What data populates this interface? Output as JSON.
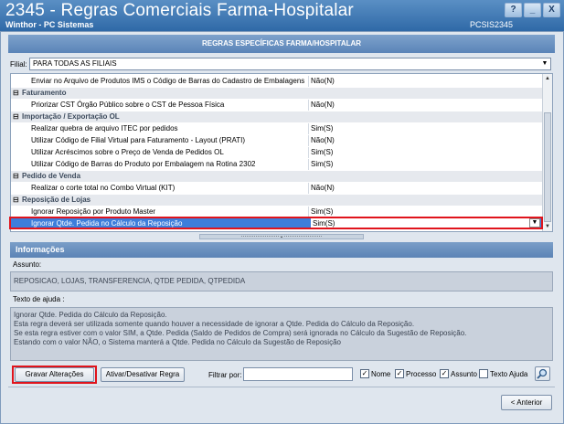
{
  "window": {
    "title": "2345 - Regras Comerciais Farma-Hospitalar",
    "subtitle": "Winthor - PC Sistemas",
    "code": "PCSIS2345",
    "buttons": [
      "?",
      "_",
      "X"
    ]
  },
  "section_header": "REGRAS ESPECÍFICAS FARMA/HOSPITALAR",
  "filial": {
    "label": "Filial:",
    "value": "PARA TODAS AS FILIAIS"
  },
  "grid": {
    "rows": [
      {
        "type": "item",
        "label": "Enviar no Arquivo de Produtos IMS o Código de Barras do Cadastro de Embalagens",
        "value": "Não(N)"
      },
      {
        "type": "group",
        "label": "Faturamento",
        "toggle": "⊟"
      },
      {
        "type": "item",
        "label": "Priorizar CST Órgão Público sobre o CST de Pessoa Física",
        "value": "Não(N)"
      },
      {
        "type": "group",
        "label": "Importação / Exportação OL",
        "toggle": "⊟"
      },
      {
        "type": "item",
        "label": "Realizar quebra de arquivo ITEC por pedidos",
        "value": "Sim(S)"
      },
      {
        "type": "item",
        "label": "Utilizar Código de Filial Virtual para Faturamento - Layout (PRATI)",
        "value": "Não(N)"
      },
      {
        "type": "item",
        "label": "Utilizar Acréscimos sobre o Preço de Venda de Pedidos OL",
        "value": "Sim(S)"
      },
      {
        "type": "item",
        "label": "Utilizar Código de Barras do Produto por Embalagem na Rotina 2302",
        "value": "Sim(S)"
      },
      {
        "type": "group",
        "label": "Pedido de Venda",
        "toggle": "⊟"
      },
      {
        "type": "item",
        "label": "Realizar o corte total no Combo Virtual (KIT)",
        "value": "Não(N)"
      },
      {
        "type": "group",
        "label": "Reposição de Lojas",
        "toggle": "⊟"
      },
      {
        "type": "item",
        "label": "Ignorar Reposição por Produto Master",
        "value": "Sim(S)"
      },
      {
        "type": "item",
        "label": "Ignorar Qtde. Pedida no Cálculo da Reposição",
        "value": "Sim(S)",
        "selected": true
      }
    ]
  },
  "info": {
    "header": "Informações",
    "assunto_label": "Assunto:",
    "assunto_value": "REPOSICAO, LOJAS, TRANSFERENCIA, QTDE PEDIDA, QTPEDIDA",
    "ajuda_label": "Texto de ajuda :",
    "ajuda_lines": [
      "Ignorar Qtde. Pedida do Cálculo da Reposição.",
      "Esta regra deverá ser utilizada somente quando houver a necessidade de ignorar a Qtde. Pedida do Cálculo da Reposição.",
      "Se esta regra estiver com o valor SIM, a Qtde. Pedida (Saldo de Pedidos de Compra) será ignorada no Cálculo da Sugestão de Reposição.",
      "Estando com  o valor NÃO, o Sistema manterá a Qtde. Pedida no Cálculo da Sugestão de Reposição"
    ]
  },
  "toolbar": {
    "save_label": "Gravar Alterações",
    "toggle_label": "Ativar/Desativar Regra",
    "filter_label": "Filtrar por:",
    "filter_value": "",
    "checks": [
      {
        "label": "Nome",
        "checked": true
      },
      {
        "label": "Processo",
        "checked": true
      },
      {
        "label": "Assunto",
        "checked": true
      },
      {
        "label": "Texto Ajuda",
        "checked": false
      }
    ]
  },
  "back_label": "< Anterior",
  "colors": {
    "title_bg": "#2f69a7",
    "selected_row": "#3d7edb",
    "highlight": "#e0141c"
  }
}
